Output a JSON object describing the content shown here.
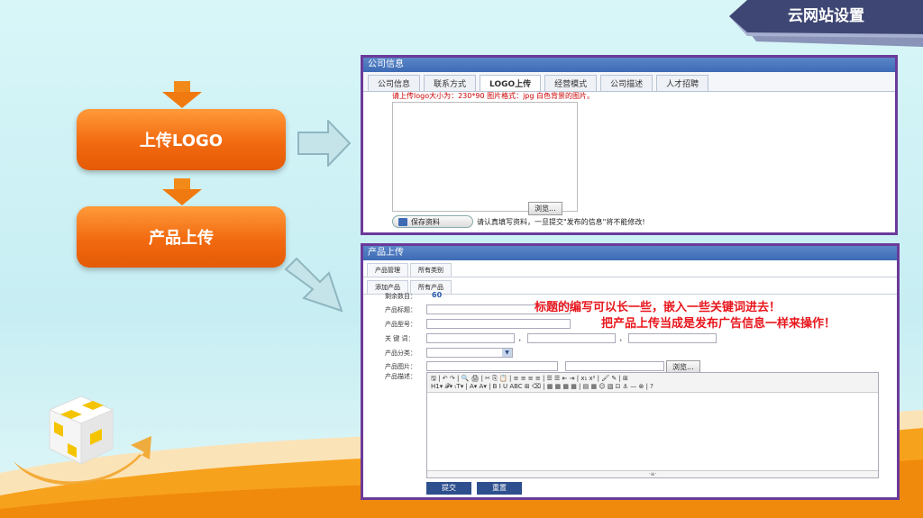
{
  "banner": {
    "title": "云网站设置"
  },
  "steps": [
    {
      "label": "上传LOGO"
    },
    {
      "label": "产品上传"
    }
  ],
  "logo_panel": {
    "header": "公司信息",
    "tabs": [
      "公司信息",
      "联系方式",
      "LOGO上传",
      "经营模式",
      "公司描述",
      "人才招聘"
    ],
    "active_tab": "LOGO上传",
    "note": "请上传logo大小为：230*90 图片格式：jpg 白色背景的图片。",
    "browse_label": "浏览...",
    "save_label": "保存资料",
    "save_hint": "请认真填写资料，一旦提交\"发布的信息\"将不能修改!"
  },
  "product_panel": {
    "header": "产品上传",
    "row1_tabs": [
      "产品管理",
      "所有类别"
    ],
    "row2_tabs": [
      "添加产品",
      "所有产品"
    ],
    "remaining_label": "剩余数目：",
    "remaining_value": "60",
    "fields": {
      "title": "产品标题：",
      "model": "产品型号：",
      "keywords": "关 键 词：",
      "category": "产品分类：",
      "image": "产品图片：",
      "description": "产品描述："
    },
    "keyword_sep": "，",
    "browse_label": "浏览...",
    "toolbar_row1": "🖫 | ↶ ↷ | 🔍 🖨 | ✂ ⎘ 📋 | ≡ ≡ ≡ ≡ | ☰ ☰ ⇤ ⇥ | x₁ x² | 🖌 ✎ | ⊞",
    "toolbar_row2": "H1▾ 𝓕▾ ₜT▾ | A▾ A▾ | B I U ABC ⊞ ⌫ | ▦ ▦ ▦ ▦ | ▤ ▦ ☺ ▧ ⊡ ⚓ — ⊗ | ?",
    "editor_footer": "·≡·",
    "submit_label": "提交",
    "reset_label": "重置",
    "red_note_1": "标题的编写可以长一些，嵌入一些关键词进去！",
    "red_note_2": "把产品上传当成是发布广告信息一样来操作！"
  },
  "colors": {
    "accent_orange": "#f26a10",
    "panel_border": "#6b3a9a",
    "header_blue": "#3d6bb5",
    "note_red": "#e8161d"
  }
}
